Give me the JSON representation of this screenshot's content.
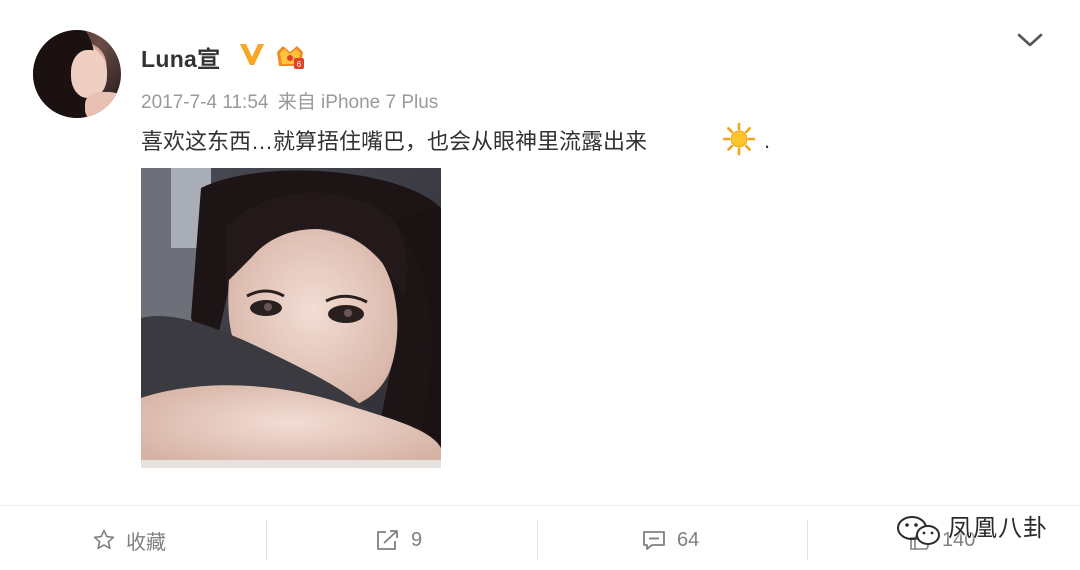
{
  "post": {
    "user_name": "Luna宣",
    "timestamp": "2017-7-4 11:54",
    "source": "来自 iPhone 7 Plus",
    "text": "喜欢这东西…就算捂住嘴巴，也会从眼神里流露出来",
    "trailing": ".",
    "emoji": "sun-emoji"
  },
  "actions": {
    "favorite_label": "收藏",
    "repost_count": "9",
    "comment_count": "64",
    "like_count": "140"
  },
  "watermark": {
    "text": "凤凰八卦"
  },
  "colors": {
    "verified_badge": "#f5a623",
    "text": "#333333",
    "meta": "#9a9a9a",
    "action": "#808080"
  }
}
